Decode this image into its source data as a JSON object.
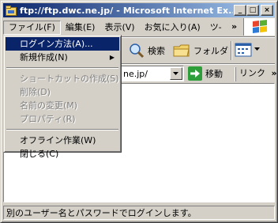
{
  "window": {
    "title": "ftp://ftp.dwc.ne.jp/ - Microsoft Internet Ex...",
    "minimize": "_",
    "maximize": "□",
    "close": "×"
  },
  "menubar": {
    "items": [
      {
        "label": "ファイル(F)"
      },
      {
        "label": "編集(E)"
      },
      {
        "label": "表示(V)"
      },
      {
        "label": "お気に入り(A)"
      },
      {
        "label": "ツ-"
      }
    ],
    "overflow": "»"
  },
  "toolbar": {
    "search_label": "検索",
    "folders_label": "フォルダ"
  },
  "address": {
    "value": "ne.jp/",
    "go_label": "移動",
    "links_label": "リンク",
    "links_overflow": "»"
  },
  "file_menu": {
    "items": [
      {
        "label": "ログイン方法(A)..."
      },
      {
        "label": "新規作成(N)",
        "submenu_arrow": "▶"
      },
      {
        "label": "ショートカットの作成(S)"
      },
      {
        "label": "削除(D)"
      },
      {
        "label": "名前の変更(M)"
      },
      {
        "label": "プロパティ(R)"
      },
      {
        "label": "オフライン作業(W)"
      },
      {
        "label": "閉じる(C)"
      }
    ]
  },
  "status": {
    "text": "別のユーザー名とパスワードでログインします。"
  },
  "colors": {
    "titlebar_start": "#0a246a",
    "titlebar_end": "#a6caf0",
    "menu_highlight": "#0a246a",
    "go_green": "#2e9e3a"
  }
}
